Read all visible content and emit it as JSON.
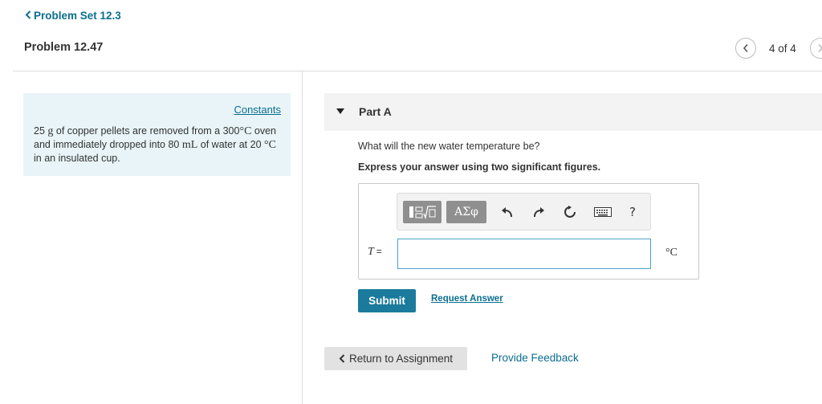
{
  "header": {
    "back_link_label": "Problem Set 12.3",
    "problem_title": "Problem 12.47",
    "page_indicator": "4 of 4"
  },
  "left_panel": {
    "constants_link": "Constants",
    "problem_text": {
      "mass": "25",
      "mass_unit": "g",
      "text1": " of copper pellets are removed from a ",
      "oven_temp": "300",
      "deg_c_1": "°C",
      "text2": " oven and immediately dropped into ",
      "volume": "80",
      "volume_unit": "mL",
      "text3": " of water at ",
      "water_temp": "20",
      "deg_c_2": "°C",
      "text4": " in an insulated cup."
    }
  },
  "part_a": {
    "label": "Part A",
    "question": "What will the new water temperature be?",
    "instruction": "Express your answer using two significant figures.",
    "toolbar": {
      "greek_label": "ΑΣφ",
      "help_label": "?",
      "icons": [
        "templates-icon",
        "greek-symbols-icon",
        "undo-icon",
        "redo-icon",
        "reset-icon",
        "keyboard-icon",
        "help-icon"
      ]
    },
    "variable_label": "T",
    "equals": "=",
    "answer_value": "",
    "unit": "°C",
    "submit_label": "Submit",
    "request_answer_label": "Request Answer"
  },
  "footer": {
    "return_label": "Return to Assignment",
    "feedback_label": "Provide Feedback"
  },
  "colors": {
    "accent": "#0b6e8f",
    "submit_bg": "#1b7b9c",
    "constants_bg": "#e8f4f7",
    "input_border": "#4da3c6"
  }
}
